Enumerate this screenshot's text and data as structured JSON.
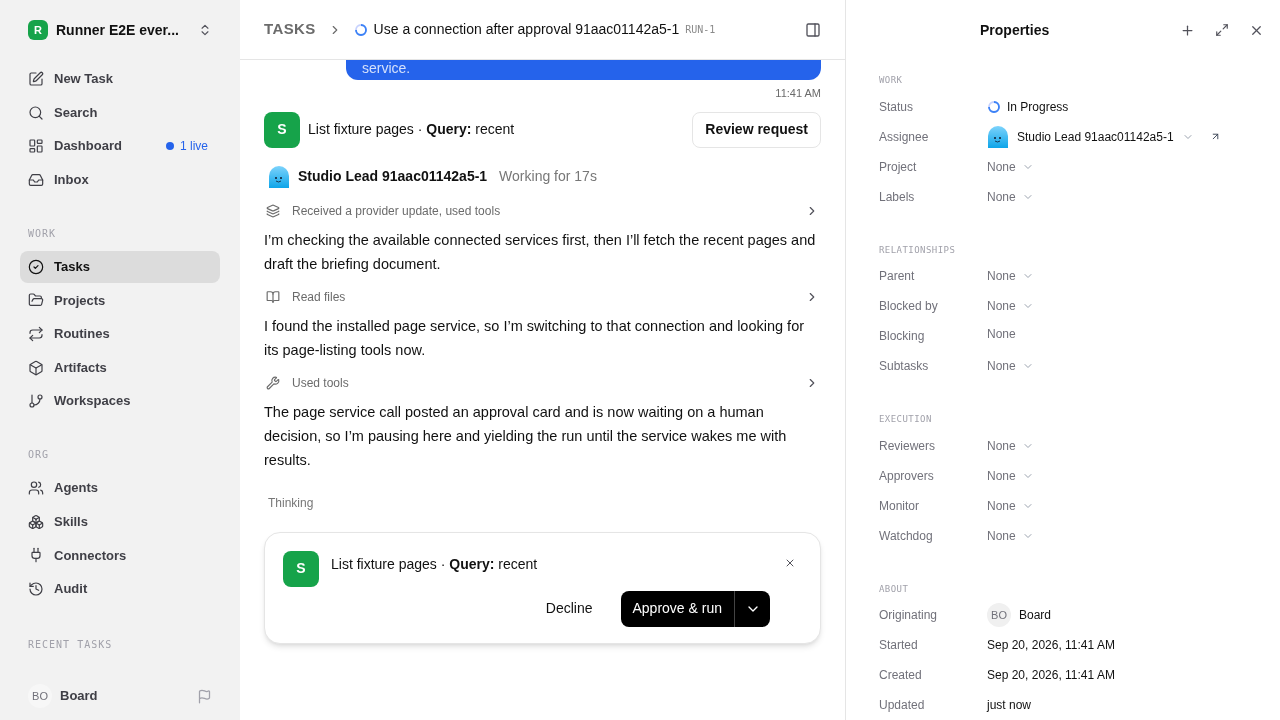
{
  "workspace": {
    "initial": "R",
    "name": "Runner E2E ever..."
  },
  "nav": [
    {
      "label": "New Task",
      "selected": false
    },
    {
      "label": "Search",
      "selected": false
    },
    {
      "label": "Dashboard",
      "selected": false,
      "badge": "1 live"
    },
    {
      "label": "Inbox",
      "selected": false
    }
  ],
  "work_section": {
    "title": "WORK",
    "items": [
      {
        "label": "Tasks",
        "selected": true
      },
      {
        "label": "Projects",
        "selected": false
      },
      {
        "label": "Routines",
        "selected": false
      },
      {
        "label": "Artifacts",
        "selected": false
      },
      {
        "label": "Workspaces",
        "selected": false
      }
    ]
  },
  "org_section": {
    "title": "ORG",
    "items": [
      {
        "label": "Agents",
        "selected": false
      },
      {
        "label": "Skills",
        "selected": false
      },
      {
        "label": "Connectors",
        "selected": false
      },
      {
        "label": "Audit",
        "selected": false
      }
    ]
  },
  "recent_title": "RECENT TASKS",
  "user": {
    "initials": "BO",
    "name": "Board"
  },
  "breadcrumb": {
    "root": "TASKS",
    "title": "Use a connection after approval 91aac01142a5-1",
    "run": "RUN-1"
  },
  "message": {
    "text": "service.",
    "time": "11:41 AM"
  },
  "request": {
    "avatar": "S",
    "text": "List fixture pages · **Query:** recent",
    "button": "Review request"
  },
  "agent": {
    "name": "Studio Lead 91aac01142a5-1",
    "status": "Working for 17s"
  },
  "feed": [
    {
      "kind": "step",
      "text": "Received a provider update, used tools"
    },
    {
      "kind": "text",
      "text": "I’m checking the available connected services first, then I’ll fetch the recent pages and draft the briefing document."
    },
    {
      "kind": "step",
      "text": "Read files"
    },
    {
      "kind": "text",
      "text": "I found the installed page service, so I’m switching to that connection and looking for its page-listing tools now."
    },
    {
      "kind": "step",
      "text": "Used tools"
    },
    {
      "kind": "text",
      "text": "The page service call posted an approval card and is now waiting on a human decision, so I’m pausing here and yielding the run until the service wakes me with results."
    }
  ],
  "thinking": "Thinking",
  "approval": {
    "avatar": "S",
    "text": "List fixture pages · **Query:** recent",
    "decline": "Decline",
    "approve": "Approve & run"
  },
  "properties": {
    "title": "Properties",
    "sections": [
      {
        "title": "WORK",
        "rows": [
          {
            "label": "Status",
            "kind": "status",
            "value": "In Progress"
          },
          {
            "label": "Assignee",
            "kind": "agent",
            "value": "Studio Lead 91aac01142a5-1"
          },
          {
            "label": "Project",
            "kind": "select",
            "value": "None"
          },
          {
            "label": "Labels",
            "kind": "select",
            "value": "None"
          }
        ]
      },
      {
        "title": "RELATIONSHIPS",
        "rows": [
          {
            "label": "Parent",
            "kind": "select",
            "value": "None"
          },
          {
            "label": "Blocked by",
            "kind": "select",
            "value": "None"
          },
          {
            "label": "Blocking",
            "kind": "plain",
            "value": "None"
          },
          {
            "label": "Subtasks",
            "kind": "select",
            "value": "None"
          }
        ]
      },
      {
        "title": "EXECUTION",
        "rows": [
          {
            "label": "Reviewers",
            "kind": "select",
            "value": "None"
          },
          {
            "label": "Approvers",
            "kind": "select",
            "value": "None"
          },
          {
            "label": "Monitor",
            "kind": "select",
            "value": "None"
          },
          {
            "label": "Watchdog",
            "kind": "select",
            "value": "None"
          }
        ]
      },
      {
        "title": "ABOUT",
        "rows": [
          {
            "label": "Originating",
            "kind": "user",
            "initials": "BO",
            "value": "Board"
          },
          {
            "label": "Started",
            "kind": "date",
            "value": "Sep 20, 2026, 11:41 AM"
          },
          {
            "label": "Created",
            "kind": "date",
            "value": "Sep 20, 2026, 11:41 AM"
          },
          {
            "label": "Updated",
            "kind": "date",
            "value": "just now"
          }
        ]
      }
    ]
  }
}
